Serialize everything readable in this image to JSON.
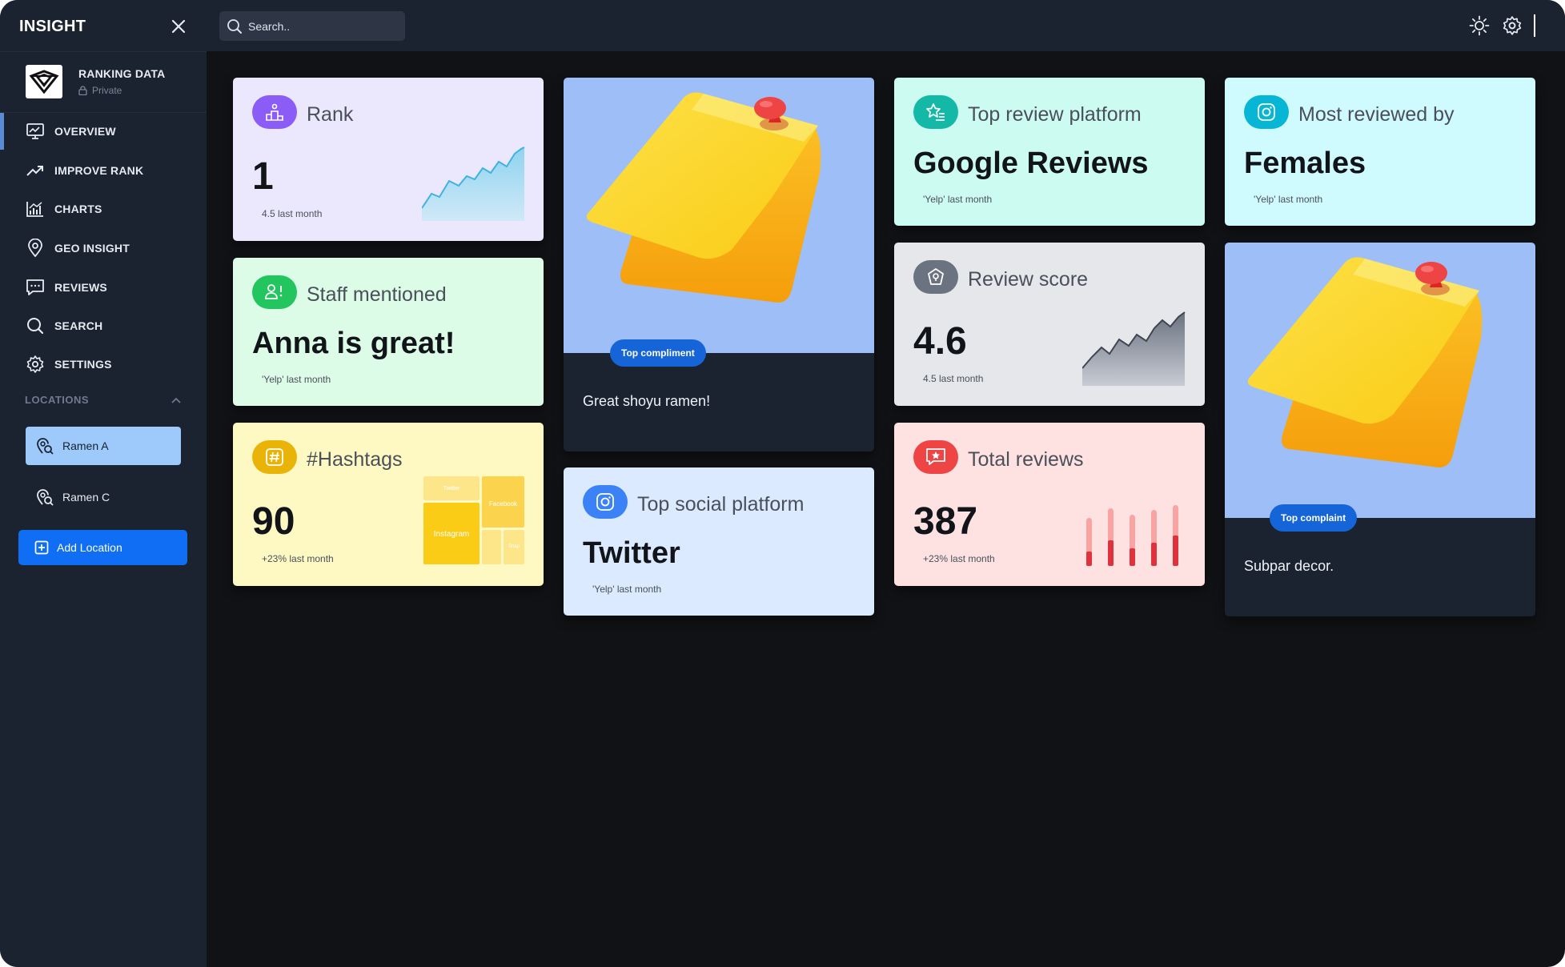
{
  "sidebar": {
    "brand": "INSIGHT",
    "project": {
      "name": "RANKING DATA",
      "privacy": "Private"
    },
    "nav": [
      {
        "label": "OVERVIEW",
        "icon": "overview-icon",
        "active": true
      },
      {
        "label": "IMPROVE RANK",
        "icon": "trend-up-icon"
      },
      {
        "label": "CHARTS",
        "icon": "charts-icon"
      },
      {
        "label": "GEO INSIGHT",
        "icon": "location-pin-icon"
      },
      {
        "label": "REVIEWS",
        "icon": "chat-icon"
      },
      {
        "label": "SEARCH",
        "icon": "search-icon"
      },
      {
        "label": "SETTINGS",
        "icon": "gear-icon"
      }
    ],
    "locations_label": "LOCATIONS",
    "locations": [
      {
        "label": "Ramen A",
        "selected": true
      },
      {
        "label": "Ramen C",
        "selected": false
      }
    ],
    "add_location": "Add Location"
  },
  "topbar": {
    "search_placeholder": "Search.."
  },
  "cards": {
    "rank": {
      "title": "Rank",
      "value": "1",
      "sub": "4.5 last month",
      "color": "#ebe8fd",
      "badge": "#8b5cf6"
    },
    "staff": {
      "title": "Staff mentioned",
      "value": "Anna is great!",
      "sub": "'Yelp' last month",
      "color": "#dcfce7",
      "badge": "#22c55e"
    },
    "hashtags": {
      "title": "#Hashtags",
      "value": "90",
      "sub": "+23% last month",
      "color": "#fef9c3",
      "badge": "#eab308",
      "treemap_labels": [
        "Twitter",
        "Facebook",
        "Instagram",
        "Snap"
      ]
    },
    "compliment": {
      "pill": "Top compliment",
      "caption": "Great shoyu ramen!"
    },
    "social": {
      "title": "Top social platform",
      "value": "Twitter",
      "sub": "'Yelp' last month",
      "color": "#dbeafe",
      "badge": "#3b82f6"
    },
    "review_platform": {
      "title": "Top review platform",
      "value": "Google Reviews",
      "sub": "'Yelp' last month",
      "color": "#ccfbf1",
      "badge": "#14b8a6"
    },
    "review_score": {
      "title": "Review score",
      "value": "4.6",
      "sub": "4.5 last month",
      "color": "#e5e7eb",
      "badge": "#6b7280"
    },
    "total_reviews": {
      "title": "Total reviews",
      "value": "387",
      "sub": "+23% last month",
      "color": "#fee2e2",
      "badge": "#ef4444",
      "bars": [
        0.3,
        0.45,
        0.35,
        0.42,
        0.5
      ]
    },
    "most_reviewed": {
      "title": "Most reviewed by",
      "value": "Females",
      "sub": "'Yelp' last month",
      "color": "#cffafe",
      "badge": "#06b6d4"
    },
    "complaint": {
      "pill": "Top complaint",
      "caption": "Subpar decor."
    }
  }
}
